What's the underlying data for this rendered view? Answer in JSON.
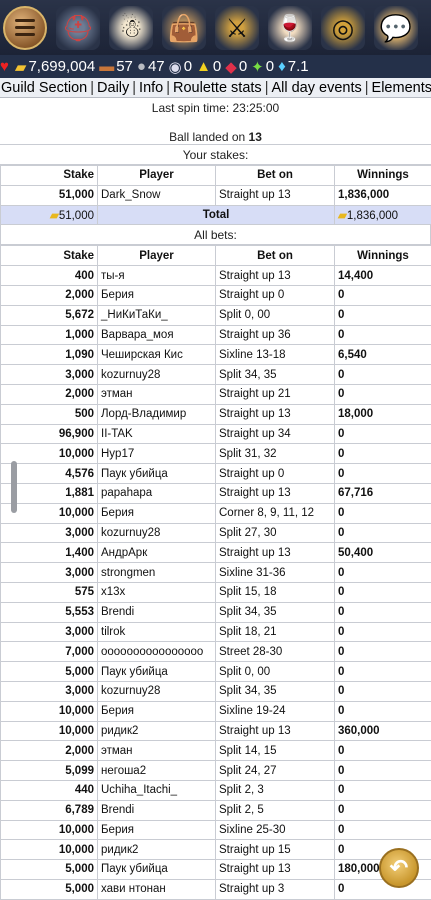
{
  "topbar": {
    "icons": [
      "menu-icon",
      "helmet-icon",
      "snowman-icon",
      "bag-icon",
      "swords-icon",
      "wine-glass-icon",
      "roulette-icon",
      "chat-icon"
    ]
  },
  "resources": [
    {
      "icon": "heart-icon",
      "value": ""
    },
    {
      "icon": "gold-icon",
      "value": "7,699,004"
    },
    {
      "icon": "wood-icon",
      "value": "57"
    },
    {
      "icon": "stone-icon",
      "value": "47"
    },
    {
      "icon": "iron-icon",
      "value": "0"
    },
    {
      "icon": "sulfur-icon",
      "value": "0"
    },
    {
      "icon": "ruby-icon",
      "value": "0"
    },
    {
      "icon": "gems-icon",
      "value": "0"
    },
    {
      "icon": "diamond-icon",
      "value": "7.1"
    }
  ],
  "nav": [
    "Guild Section",
    "Daily",
    "Info",
    "Roulette stats",
    "All day events",
    "Elements ca"
  ],
  "spin": {
    "last_spin": "Last spin time: 23:25:00",
    "ball_prefix": "Ball landed on ",
    "ball_number": "13"
  },
  "headers": {
    "stake": "Stake",
    "player": "Player",
    "bet_on": "Bet on",
    "winnings": "Winnings"
  },
  "your_stakes": {
    "title": "Your stakes:",
    "rows": [
      {
        "stake": "51,000",
        "player": "Dark_Snow",
        "bet": "Straight up 13",
        "win": "1,836,000"
      }
    ],
    "total_label": "Total",
    "total_stake": "51,000",
    "total_win": "1,836,000"
  },
  "all_bets": {
    "title": "All bets:",
    "rows": [
      {
        "stake": "400",
        "player": "ты-я",
        "bet": "Straight up 13",
        "win": "14,400"
      },
      {
        "stake": "2,000",
        "player": "Берия",
        "bet": "Straight up 0",
        "win": "0"
      },
      {
        "stake": "5,672",
        "player": "_НиКиТаКи_",
        "bet": "Split 0, 00",
        "win": "0"
      },
      {
        "stake": "1,000",
        "player": "Варвара_моя",
        "bet": "Straight up 36",
        "win": "0"
      },
      {
        "stake": "1,090",
        "player": "Чеширская Кис",
        "bet": "Sixline 13-18",
        "win": "6,540"
      },
      {
        "stake": "3,000",
        "player": "kozurnuy28",
        "bet": "Split 34, 35",
        "win": "0"
      },
      {
        "stake": "2,000",
        "player": "этман",
        "bet": "Straight up 21",
        "win": "0"
      },
      {
        "stake": "500",
        "player": "Лорд-Владимир",
        "bet": "Straight up 13",
        "win": "18,000"
      },
      {
        "stake": "96,900",
        "player": "II-TAK",
        "bet": "Straight up 34",
        "win": "0"
      },
      {
        "stake": "10,000",
        "player": "Hyp17",
        "bet": "Split 31, 32",
        "win": "0"
      },
      {
        "stake": "4,576",
        "player": "Паук убийца",
        "bet": "Straight up 0",
        "win": "0"
      },
      {
        "stake": "1,881",
        "player": "paрahapa",
        "bet": "Straight up 13",
        "win": "67,716"
      },
      {
        "stake": "10,000",
        "player": "Берия",
        "bet": "Corner 8, 9, 11, 12",
        "win": "0"
      },
      {
        "stake": "3,000",
        "player": "kozurnuy28",
        "bet": "Split 27, 30",
        "win": "0"
      },
      {
        "stake": "1,400",
        "player": "АндрАрк",
        "bet": "Straight up 13",
        "win": "50,400"
      },
      {
        "stake": "3,000",
        "player": "strongmen",
        "bet": "Sixline 31-36",
        "win": "0"
      },
      {
        "stake": "575",
        "player": "x13x",
        "bet": "Split 15, 18",
        "win": "0"
      },
      {
        "stake": "5,553",
        "player": "Brendi",
        "bet": "Split 34, 35",
        "win": "0"
      },
      {
        "stake": "3,000",
        "player": "tilrok",
        "bet": "Split 18, 21",
        "win": "0"
      },
      {
        "stake": "7,000",
        "player": "oooooooooooooooo",
        "bet": "Street 28-30",
        "win": "0"
      },
      {
        "stake": "5,000",
        "player": "Паук убийца",
        "bet": "Split 0, 00",
        "win": "0"
      },
      {
        "stake": "3,000",
        "player": "kozurnuy28",
        "bet": "Split 34, 35",
        "win": "0"
      },
      {
        "stake": "10,000",
        "player": "Берия",
        "bet": "Sixline 19-24",
        "win": "0"
      },
      {
        "stake": "10,000",
        "player": "ридик2",
        "bet": "Straight up 13",
        "win": "360,000"
      },
      {
        "stake": "2,000",
        "player": "этман",
        "bet": "Split 14, 15",
        "win": "0"
      },
      {
        "stake": "5,099",
        "player": "негоша2",
        "bet": "Split 24, 27",
        "win": "0"
      },
      {
        "stake": "440",
        "player": "Uchiha_Itachi_",
        "bet": "Split 2, 3",
        "win": "0"
      },
      {
        "stake": "6,789",
        "player": "Brendi",
        "bet": "Split 2, 5",
        "win": "0"
      },
      {
        "stake": "10,000",
        "player": "Берия",
        "bet": "Sixline 25-30",
        "win": "0"
      },
      {
        "stake": "10,000",
        "player": "ридик2",
        "bet": "Straight up 15",
        "win": "0"
      },
      {
        "stake": "5,000",
        "player": "Паук убийца",
        "bet": "Straight up 13",
        "win": "180,000"
      },
      {
        "stake": "5,000",
        "player": "хави нтонан",
        "bet": "Straight up 3",
        "win": "0"
      }
    ]
  },
  "colors": {
    "total_row_bg": "#d7ddf6",
    "topbar_bg": "#243049",
    "coin": "#e8b820"
  }
}
